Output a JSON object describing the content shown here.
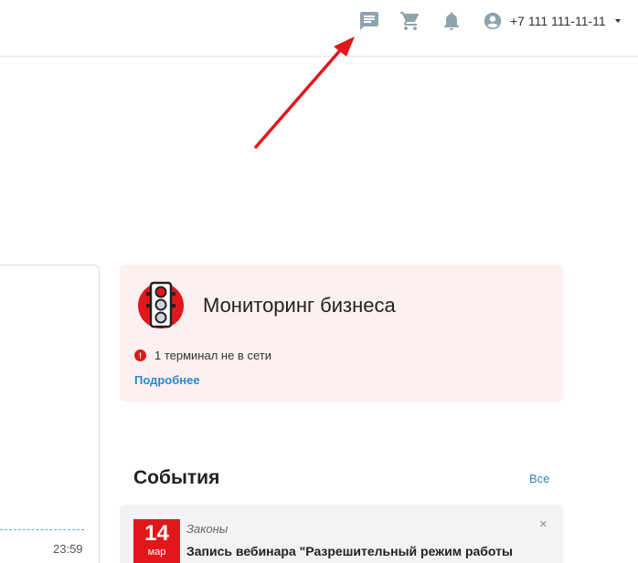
{
  "header": {
    "icons": [
      "chat-icon",
      "cart-icon",
      "bell-icon",
      "account-icon"
    ],
    "phone": "+7 111 111-11-11",
    "icon_color": "#8fa3ae"
  },
  "left_panel": {
    "time": "23:59"
  },
  "monitoring": {
    "title": "Мониторинг бизнеса",
    "status_text": "1 терминал не в сети",
    "status_icon": "!",
    "link": "Подробнее",
    "background": "#fdf0f0",
    "accent": "#e3171b"
  },
  "events": {
    "title": "События",
    "all_link": "Все",
    "items": [
      {
        "day": "14",
        "month": "мар",
        "category": "Законы",
        "title": "Запись вебинара \"Разрешительный режим работы",
        "close": "×"
      }
    ]
  },
  "annotation": {
    "arrow_color": "#e3171b"
  }
}
